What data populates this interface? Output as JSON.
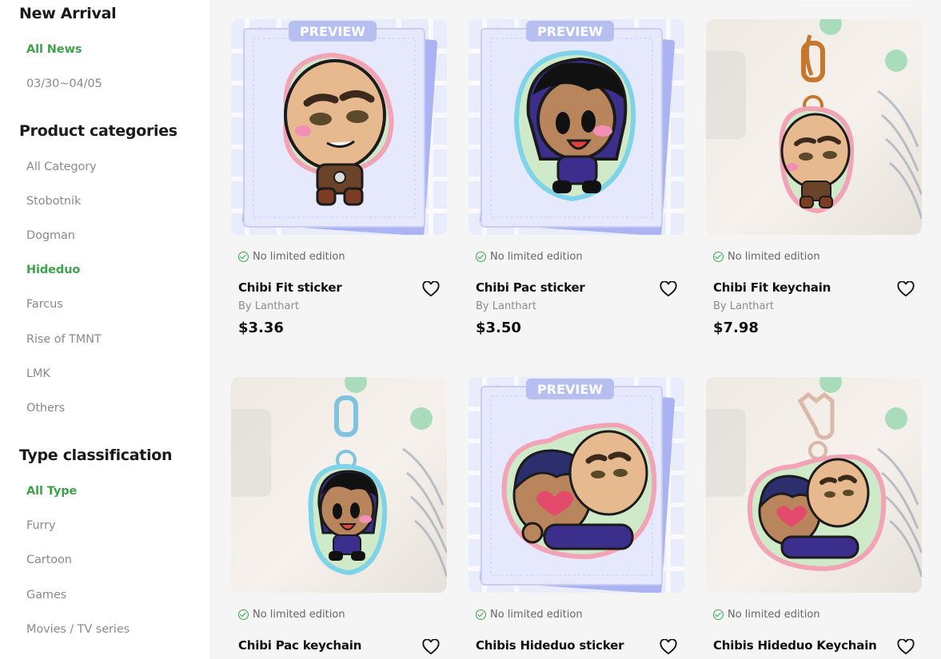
{
  "sidebar": {
    "new_arrival": {
      "title": "New Arrival",
      "items": [
        {
          "label": "All News",
          "active": true
        },
        {
          "label": "03/30~04/05",
          "active": false
        }
      ]
    },
    "product_categories": {
      "title": "Product categories",
      "items": [
        {
          "label": "All Category",
          "active": false
        },
        {
          "label": "Stobotnik",
          "active": false
        },
        {
          "label": "Dogman",
          "active": false
        },
        {
          "label": "Hideduo",
          "active": true
        },
        {
          "label": "Farcus",
          "active": false
        },
        {
          "label": "Rise of TMNT",
          "active": false
        },
        {
          "label": "LMK",
          "active": false
        },
        {
          "label": "Others",
          "active": false
        }
      ]
    },
    "type_classification": {
      "title": "Type classification",
      "items": [
        {
          "label": "All Type",
          "active": true
        },
        {
          "label": "Furry",
          "active": false
        },
        {
          "label": "Cartoon",
          "active": false
        },
        {
          "label": "Games",
          "active": false
        },
        {
          "label": "Movies / TV series",
          "active": false
        }
      ]
    }
  },
  "products": [
    {
      "name": "Chibi Fit sticker",
      "edition": "No limited edition",
      "by": "By Lanthart",
      "price": "$3.36",
      "image": "sticker",
      "preview": "PREVIEW",
      "character": "fit"
    },
    {
      "name": "Chibi Pac sticker",
      "edition": "No limited edition",
      "by": "By Lanthart",
      "price": "$3.50",
      "image": "sticker",
      "preview": "PREVIEW",
      "character": "pac"
    },
    {
      "name": "Chibi Fit keychain",
      "edition": "No limited edition",
      "by": "By Lanthart",
      "price": "$7.98",
      "image": "keychain",
      "character": "fit"
    },
    {
      "name": "Chibi Pac keychain",
      "edition": "No limited edition",
      "image": "keychain",
      "character": "pac"
    },
    {
      "name": "Chibis Hideduo sticker",
      "edition": "No limited edition",
      "image": "sticker",
      "preview": "PREVIEW",
      "character": "duo"
    },
    {
      "name": "Chibis Hideduo Keychain",
      "edition": "No limited edition",
      "image": "keychain",
      "character": "duo"
    }
  ],
  "colors": {
    "accent_green": "#3fa34d",
    "text_muted": "#8a8a8a",
    "main_bg": "#f5f5f5",
    "sticker_bg": "#e9ecfb"
  },
  "icons": {
    "edition": "check-circle-icon",
    "favorite": "heart-icon"
  }
}
